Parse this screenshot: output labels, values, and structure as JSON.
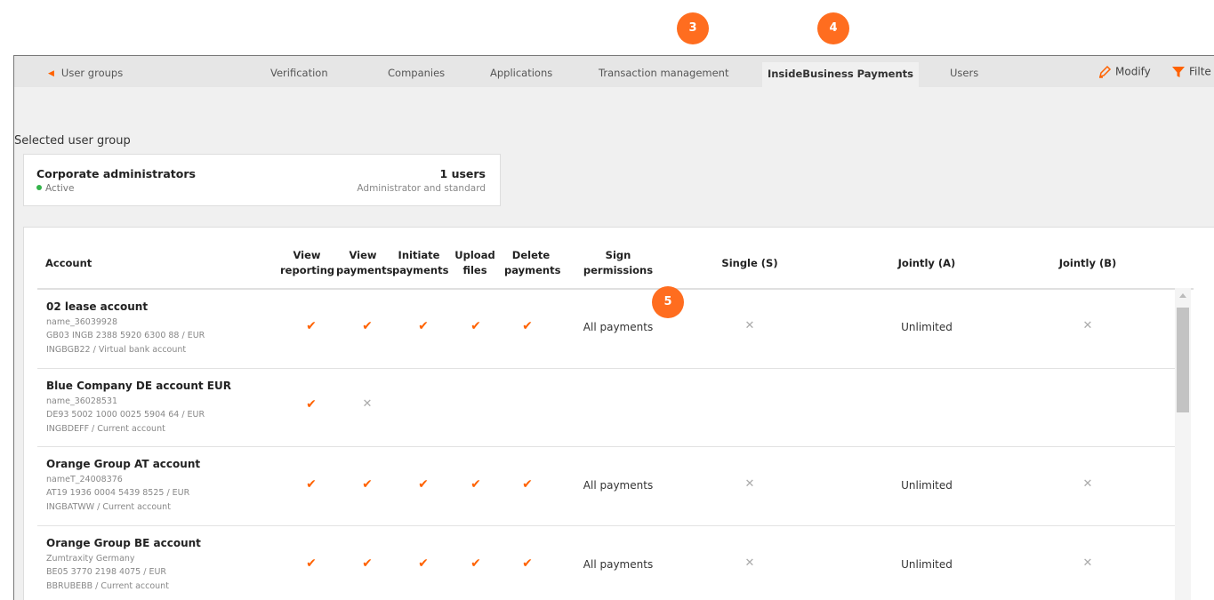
{
  "nav": {
    "back_label": "User groups",
    "tabs": [
      "Verification",
      "Companies",
      "Applications",
      "Transaction management",
      "InsideBusiness Payments",
      "Users"
    ],
    "active_tab": "InsideBusiness Payments",
    "modify_label": "Modify",
    "filter_label": "Filte"
  },
  "badges": [
    "3",
    "4",
    "5"
  ],
  "selected_group": {
    "section_label": "Selected user group",
    "name": "Corporate administrators",
    "status": "Active",
    "users": "1 users",
    "type": "Administrator and standard"
  },
  "table": {
    "columns": {
      "account": "Account",
      "view_reporting": [
        "View",
        "reporting"
      ],
      "view_payments": [
        "View",
        "payments"
      ],
      "initiate_payments": [
        "Initiate",
        "payments"
      ],
      "upload_files": [
        "Upload",
        "files"
      ],
      "delete_payments": [
        "Delete",
        "payments"
      ],
      "sign_permissions": [
        "Sign",
        "permissions"
      ],
      "single": "Single (S)",
      "jointly_a": "Jointly (A)",
      "jointly_b": "Jointly (B)"
    },
    "rows": [
      {
        "name": "02 lease account",
        "line1": "name_36039928",
        "line2": "GB03 INGB 2388 5920 6300 88 / EUR",
        "line3": "INGBGB22 / Virtual bank account",
        "view_reporting": "✔",
        "view_payments": "✔",
        "initiate_payments": "✔",
        "upload_files": "✔",
        "delete_payments": "✔",
        "sign_permissions": "All payments",
        "single": "✕",
        "jointly_a": "Unlimited",
        "jointly_b": "✕"
      },
      {
        "name": "Blue Company DE account EUR",
        "line1": "name_36028531",
        "line2": "DE93 5002 1000 0025 5904 64 / EUR",
        "line3": "INGBDEFF / Current account",
        "view_reporting": "✔",
        "view_payments": "✕",
        "initiate_payments": "",
        "upload_files": "",
        "delete_payments": "",
        "sign_permissions": "",
        "single": "",
        "jointly_a": "",
        "jointly_b": ""
      },
      {
        "name": "Orange Group AT account",
        "line1": "nameT_24008376",
        "line2": "AT19 1936 0004 5439 8525 / EUR",
        "line3": "INGBATWW / Current account",
        "view_reporting": "✔",
        "view_payments": "✔",
        "initiate_payments": "✔",
        "upload_files": "✔",
        "delete_payments": "✔",
        "sign_permissions": "All payments",
        "single": "✕",
        "jointly_a": "Unlimited",
        "jointly_b": "✕"
      },
      {
        "name": "Orange Group BE account",
        "line1": "Zumtraxity Germany",
        "line2": "BE05 3770 2198 4075 / EUR",
        "line3": "BBRUBEBB / Current account",
        "view_reporting": "✔",
        "view_payments": "✔",
        "initiate_payments": "✔",
        "upload_files": "✔",
        "delete_payments": "✔",
        "sign_permissions": "All payments",
        "single": "✕",
        "jointly_a": "Unlimited",
        "jointly_b": "✕"
      }
    ]
  },
  "colors": {
    "accent": "#ff6200",
    "badge": "#ff6d1f",
    "active_dot": "#34b34a"
  }
}
